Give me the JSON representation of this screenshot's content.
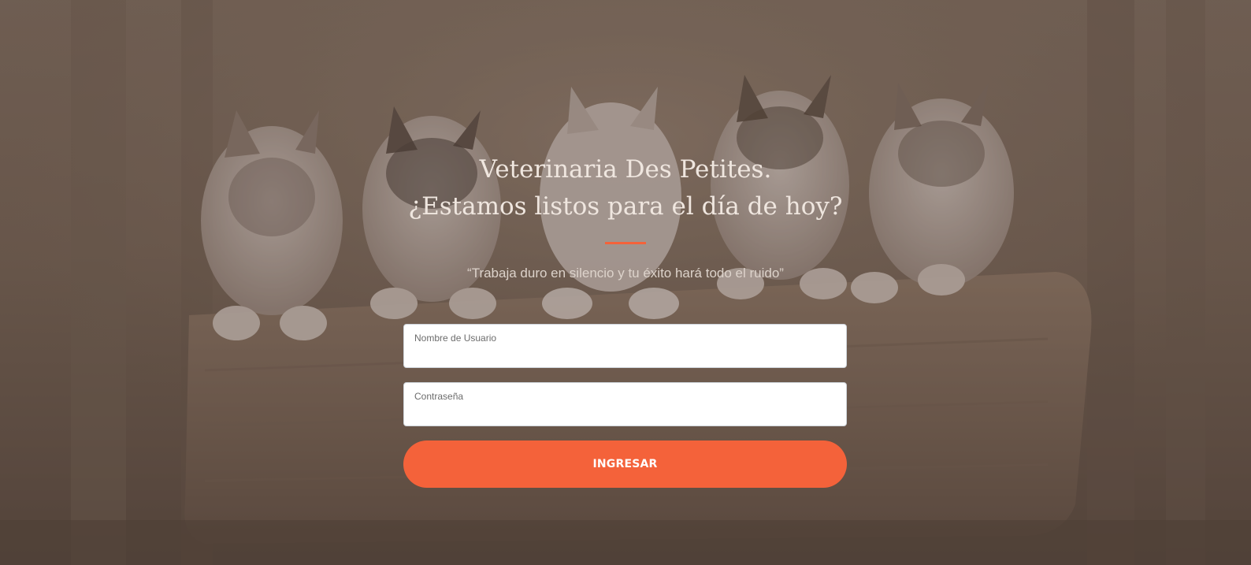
{
  "hero": {
    "title_line1": "Veterinaria Des Petites.",
    "title_line2": "¿Estamos listos para el día de hoy?",
    "quote": "“Trabaja duro en silencio y tu éxito hará todo el ruido”"
  },
  "form": {
    "username_label": "Nombre de Usuario",
    "username_value": "",
    "password_label": "Contraseña",
    "password_value": "",
    "submit_label": "INGRESAR"
  },
  "colors": {
    "accent": "#f4623a",
    "title_text": "#efe6df",
    "field_background": "#ffffff"
  },
  "icons": {
    "background": "husky-puppies-on-log-photo"
  }
}
